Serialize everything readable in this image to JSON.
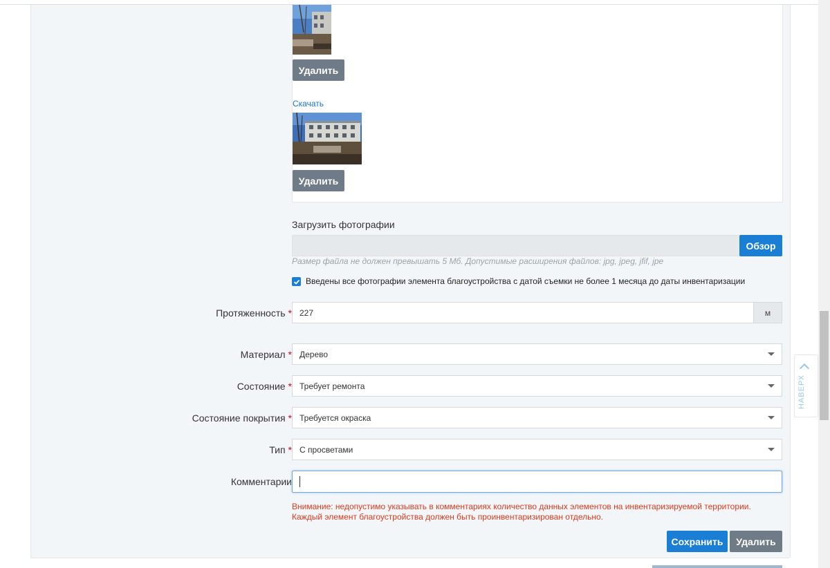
{
  "gallery": {
    "photos": [
      {
        "name": "building-photo-1",
        "delete_label": "Удалить"
      },
      {
        "name": "building-photo-2",
        "delete_label": "Удалить",
        "download_label": "Скачать"
      }
    ]
  },
  "upload": {
    "label": "Загрузить фотографии",
    "browse_label": "Обзор",
    "hint": "Размер файла не должен превышать 5 Мб. Допустимые расширения файлов: jpg, jpeg, jfif, jpe"
  },
  "photo_confirm": {
    "checked": true,
    "label": "Введены все фотографии элемента благоустройства с датой съемки не более 1 месяца до даты инвентаризации"
  },
  "form": {
    "length": {
      "label": "Протяженность",
      "required": "*",
      "value": "227",
      "unit": "м"
    },
    "material": {
      "label": "Материал",
      "required": "*",
      "value": "Дерево"
    },
    "condition": {
      "label": "Состояние",
      "required": "*",
      "value": "Требует ремонта"
    },
    "coating": {
      "label": "Состояние покрытия",
      "required": "*",
      "value": "Требуется окраска"
    },
    "type": {
      "label": "Тип",
      "required": "*",
      "value": "С просветами"
    },
    "comments": {
      "label": "Комментарии",
      "value": ""
    }
  },
  "warning": "Внимание: недопустимо указывать в комментариях количество данных элементов на инвентаризируемой территории. Каждый элемент благоустройства должен быть проинвентаризирован отдельно.",
  "actions": {
    "save_label": "Сохранить",
    "delete_label": "Удалить"
  },
  "to_top": {
    "label": "НАВЕРХ"
  },
  "colors": {
    "primary": "#1a7fd4",
    "secondary": "#6f7c87",
    "warning": "#e0391c",
    "required": "#d0021b"
  }
}
